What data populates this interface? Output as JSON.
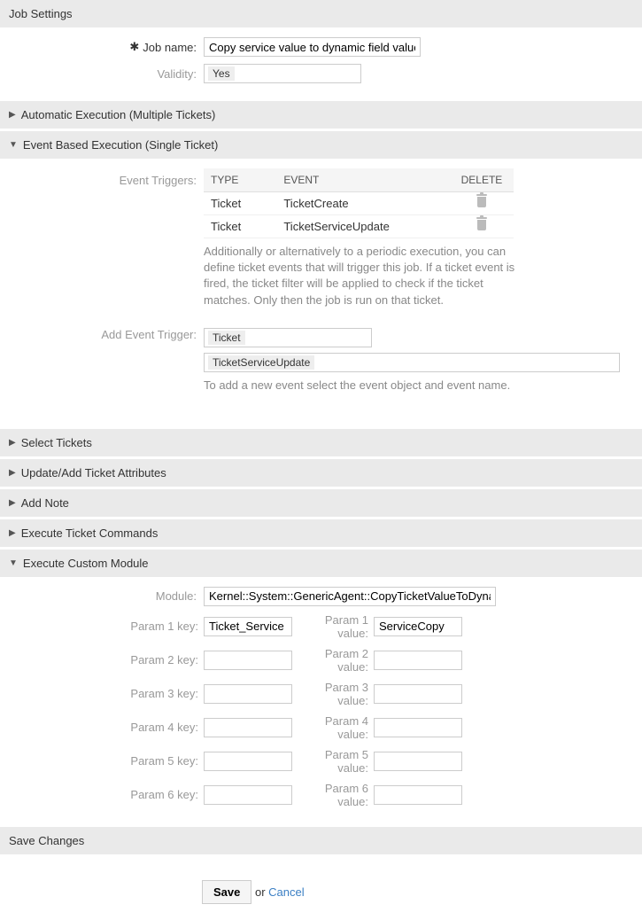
{
  "headers": {
    "job_settings": "Job Settings",
    "auto_exec": "Automatic Execution (Multiple Tickets)",
    "event_exec": "Event Based Execution (Single Ticket)",
    "select_tickets": "Select Tickets",
    "update_add": "Update/Add Ticket Attributes",
    "add_note": "Add Note",
    "exec_cmds": "Execute Ticket Commands",
    "exec_module": "Execute Custom Module",
    "save_changes": "Save Changes"
  },
  "labels": {
    "job_name": "Job name:",
    "validity": "Validity:",
    "event_triggers": "Event Triggers:",
    "add_event_trigger": "Add Event Trigger:",
    "module": "Module:",
    "param1k": "Param 1 key:",
    "param1v": "Param 1 value:",
    "param2k": "Param 2 key:",
    "param2v": "Param 2 value:",
    "param3k": "Param 3 key:",
    "param3v": "Param 3 value:",
    "param4k": "Param 4 key:",
    "param4v": "Param 4 value:",
    "param5k": "Param 5 key:",
    "param5v": "Param 5 value:",
    "param6k": "Param 6 key:",
    "param6v": "Param 6 value:"
  },
  "values": {
    "job_name": "Copy service value to dynamic field value",
    "validity": "Yes",
    "module": "Kernel::System::GenericAgent::CopyTicketValueToDynamicF",
    "param1k": "Ticket_Service",
    "param1v": "ServiceCopy",
    "param2k": "",
    "param2v": "",
    "param3k": "",
    "param3v": "",
    "param4k": "",
    "param4v": "",
    "param5k": "",
    "param5v": "",
    "param6k": "",
    "param6v": "",
    "add_event_type": "Ticket",
    "add_event_name": "TicketServiceUpdate"
  },
  "table": {
    "cols": {
      "type": "TYPE",
      "event": "EVENT",
      "delete": "DELETE"
    },
    "rows": [
      {
        "type": "Ticket",
        "event": "TicketCreate"
      },
      {
        "type": "Ticket",
        "event": "TicketServiceUpdate"
      }
    ]
  },
  "helptext": {
    "triggers": "Additionally or alternatively to a periodic execution, you can define ticket events that will trigger this job. If a ticket event is fired, the ticket filter will be applied to check if the ticket matches. Only then the job is run on that ticket.",
    "add_event": "To add a new event select the event object and event name."
  },
  "actions": {
    "save": "Save",
    "or": " or ",
    "cancel": "Cancel"
  }
}
